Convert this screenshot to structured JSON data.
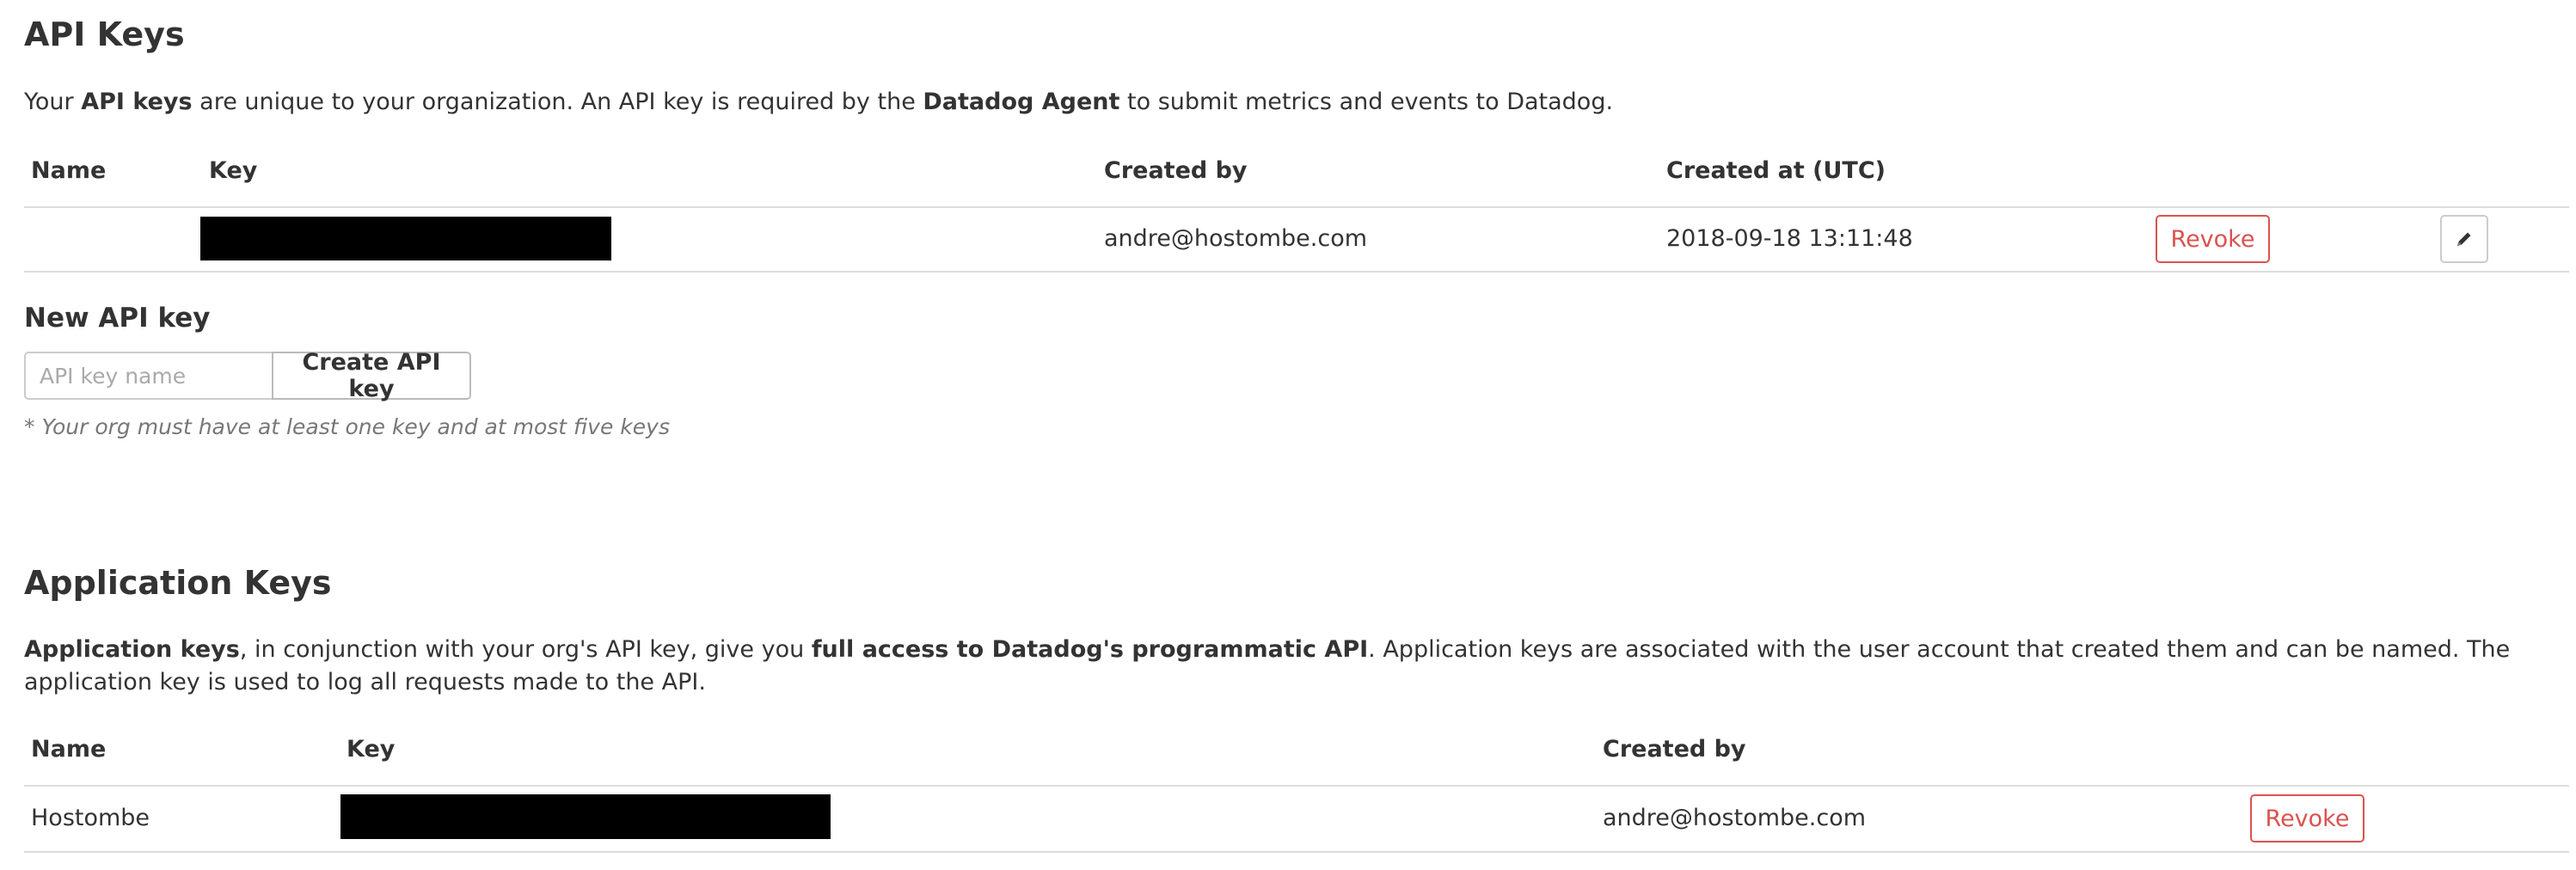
{
  "api_keys": {
    "title": "API Keys",
    "description": {
      "p1": "Your ",
      "b1": "API keys",
      "p2": " are unique to your organization. An API key is required by the ",
      "b2": "Datadog Agent",
      "p3": " to submit metrics and events to Datadog."
    },
    "columns": {
      "name": "Name",
      "key": "Key",
      "created_by": "Created by",
      "created_at": "Created at (UTC)"
    },
    "rows": [
      {
        "name": "",
        "key": "",
        "created_by": "andre@hostombe.com",
        "created_at": "2018-09-18 13:11:48",
        "revoke_label": "Revoke",
        "edit_icon": "pencil-icon"
      }
    ]
  },
  "new_api_key": {
    "title": "New API key",
    "input_value": "",
    "input_placeholder": "API key name",
    "create_label": "Create API key",
    "note": "* Your org must have at least one key and at most five keys"
  },
  "application_keys": {
    "title": "Application Keys",
    "description": {
      "b1": "Application keys",
      "p1": ", in conjunction with your org's API key, give you ",
      "b2": "full access to Datadog's programmatic API",
      "p2": ". Application keys are associated with the user account that created them and can be named. The application key is used to log all requests made to the API."
    },
    "columns": {
      "name": "Name",
      "key": "Key",
      "created_by": "Created by"
    },
    "rows": [
      {
        "name": "Hostombe",
        "key": "",
        "created_by": "andre@hostombe.com",
        "revoke_label": "Revoke"
      }
    ]
  },
  "colors": {
    "danger": "#d9534f",
    "text": "#333333",
    "border": "#dddddd",
    "redacted": "#000000"
  }
}
